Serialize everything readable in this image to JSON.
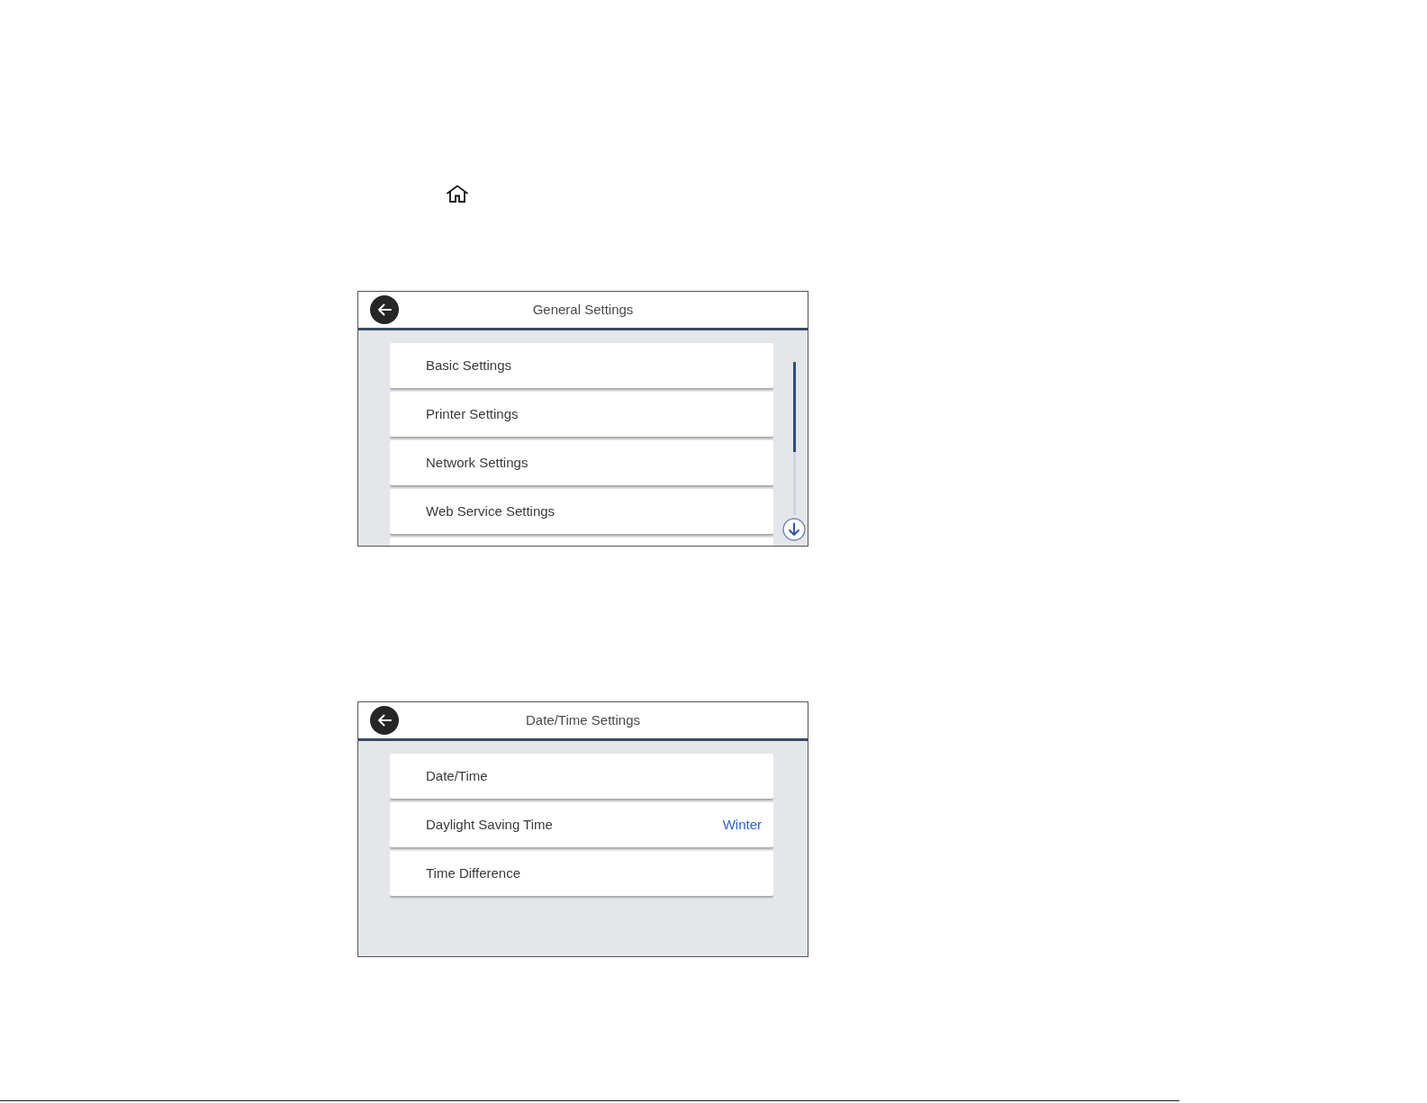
{
  "screens": [
    {
      "title": "General Settings",
      "scrollable": true,
      "items": [
        {
          "label": "Basic Settings"
        },
        {
          "label": "Printer Settings"
        },
        {
          "label": "Network Settings"
        },
        {
          "label": "Web Service Settings"
        }
      ]
    },
    {
      "title": "Date/Time Settings",
      "scrollable": false,
      "items": [
        {
          "label": "Date/Time"
        },
        {
          "label": "Daylight Saving Time",
          "value": "Winter"
        },
        {
          "label": "Time Difference"
        }
      ]
    }
  ]
}
